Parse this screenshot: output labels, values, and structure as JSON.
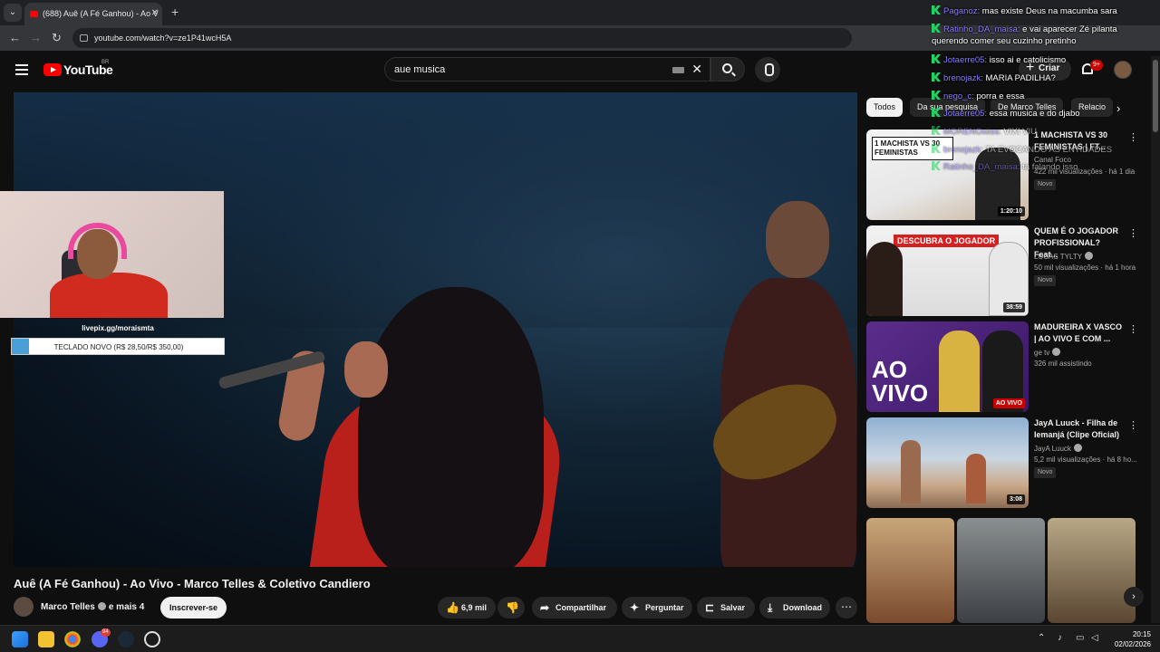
{
  "browser": {
    "tab_title": "(688) Auê (A Fé Ganhou) - Ao V",
    "url": "youtube.com/watch?v=ze1P41wcH5A"
  },
  "header": {
    "logo_text": "YouTube",
    "country": "BR",
    "search_value": "aue musica",
    "create_label": "Criar",
    "notifications": "9+"
  },
  "overlay": {
    "pix_url": "livepix.gg/moraismta",
    "goal_text": "TECLADO NOVO (R$ 28,50/R$ 350,00)",
    "goal_progress": 0.081
  },
  "video": {
    "title": "Auê (A Fé Ganhou) - Ao Vivo - Marco Telles & Coletivo Candiero",
    "channel": "Marco Telles",
    "channel_extra": "e mais 4",
    "subscribe_label": "Inscrever-se",
    "likes": "6,9 mil",
    "share_label": "Compartilhar",
    "ask_label": "Perguntar",
    "save_label": "Salvar",
    "download_label": "Download"
  },
  "chips": [
    "Todos",
    "Da sua pesquisa",
    "De Marco Telles",
    "Relacio"
  ],
  "recommendations": [
    {
      "title": "1 MACHISTA VS 30 FEMINISTAS | FT...",
      "channel": "Canal Foco",
      "views": "422 mil visualizações",
      "age": "há 1 dia",
      "badge": "Novo",
      "duration": "1:20:10",
      "thumb_text": "1 MACHISTA VS 30 FEMINISTAS"
    },
    {
      "title": "QUEM É O JOGADOR PROFISSIONAL? Feat...",
      "channel": "LUCAS TYLTY",
      "views": "50 mil visualizações",
      "age": "há 1 hora",
      "badge": "Novo",
      "duration": "38:59",
      "thumb_text": "DESCUBRA O JOGADOR"
    },
    {
      "title": "MADUREIRA X VASCO | AO VIVO E COM ...",
      "channel": "ge tv",
      "views": "326 mil assistindo",
      "age": "",
      "badge": "",
      "duration": "AO VIVO",
      "thumb_text": "AO VIVO"
    },
    {
      "title": "JayA Luuck - Filha de Iemanjá (Clipe Oficial)",
      "channel": "JayA Luuck",
      "views": "5,2 mil visualizações",
      "age": "há 8 ho...",
      "badge": "Novo",
      "duration": "3:08",
      "thumb_text": ""
    }
  ],
  "chat": [
    {
      "user": "Paganoz:",
      "msg": "mas existe Deus na macumba sara"
    },
    {
      "user": "Ratinho_DA_maisa:",
      "msg": "e vai aparecer Zé pilanta querendo comer seu cuzinho pretinho"
    },
    {
      "user": "Jotaerre05:",
      "msg": "isso ai e catolicismo"
    },
    {
      "user": "brenojazk:",
      "msg": "MARIA PADILHA?"
    },
    {
      "user": "nego_c:",
      "msg": "porra e essa"
    },
    {
      "user": "Jotaerre05:",
      "msg": "essa musica e do djabo"
    },
    {
      "user": "MORENOxiiss:",
      "msg": "VIXI VIU"
    },
    {
      "user": "brenojazk:",
      "msg": "TA EVOCANDO AS ENTIDADES"
    },
    {
      "user": "Ratinho_DA_maisa:",
      "msg": "ta falando isso"
    }
  ],
  "taskbar": {
    "time": "20:15",
    "date": "02/02/2026",
    "discord_badge": "94"
  }
}
